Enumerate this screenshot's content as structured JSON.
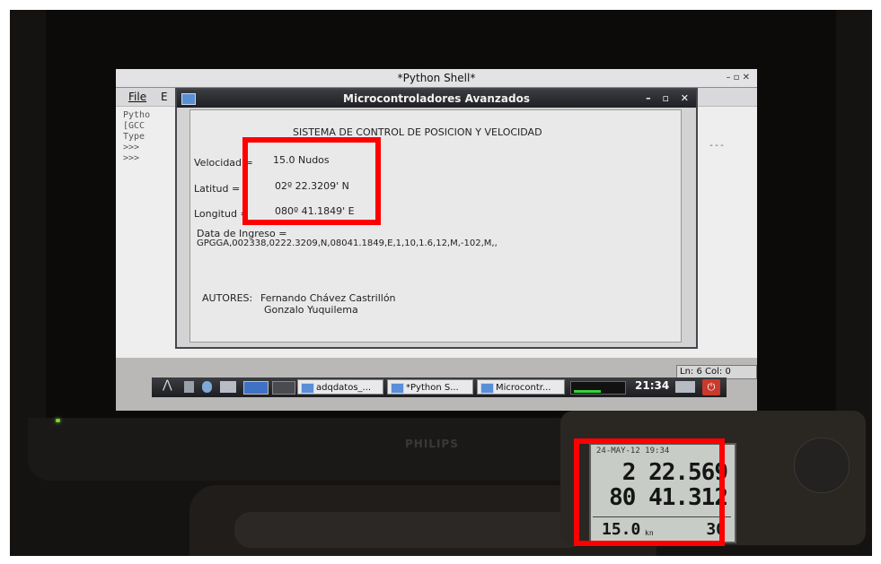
{
  "shell_window": {
    "title": "*Python Shell*",
    "menu": [
      "File",
      "E"
    ],
    "lines": [
      "Pytho",
      "[GCC",
      "Type",
      ">>>",
      ">>>"
    ],
    "status_line": "Ln: 6",
    "status_col": "Col: 0"
  },
  "mc_window": {
    "title": "Microcontroladores Avanzados",
    "heading": "SISTEMA DE CONTROL DE POSICION Y VELOCIDAD",
    "fields": [
      {
        "label": "Velocidad =",
        "value": "15.0 Nudos"
      },
      {
        "label": "Latitud =",
        "value": "02º 22.3209' N"
      },
      {
        "label": "Longitud =",
        "value": "080º 41.1849' E"
      }
    ],
    "data_label": "Data de Ingreso =",
    "data_value": "GPGGA,002338,0222.3209,N,08041.1849,E,1,10,1.6,12,M,-102,M,,",
    "authors_label": "AUTORES:",
    "author_1": "Fernando Chávez Castrillón",
    "author_2": "Gonzalo Yuquilema"
  },
  "taskbar": {
    "buttons": [
      "adqdatos_...",
      "*Python S...",
      "Microcontr..."
    ],
    "clock": "21:34"
  },
  "monitor": {
    "brand": "PHILIPS"
  },
  "gps_device": {
    "header": "24-MAY-12  19:34",
    "latitude": "2 22.569",
    "longitude": "80 41.312",
    "speed": "15.0",
    "speed_unit": "kn",
    "right_value": "30"
  },
  "colors": {
    "highlight": "#ff0000"
  }
}
